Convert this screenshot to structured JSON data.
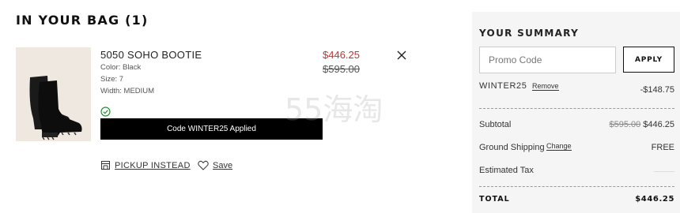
{
  "bag": {
    "title": "IN YOUR BAG (1)"
  },
  "item": {
    "name": "5050 SOHO BOOTIE",
    "color": "Color: Black",
    "size": "Size: 7",
    "width": "Width: MEDIUM",
    "sale_price": "$446.25",
    "original_price": "$595.00",
    "code_applied": "Code WINTER25 Applied",
    "pickup_label": "PICKUP INSTEAD",
    "save_label": "Save",
    "image_icon": "boot-icon"
  },
  "watermark": "55海淘",
  "summary": {
    "title": "YOUR SUMMARY",
    "promo_placeholder": "Promo Code",
    "apply_label": "APPLY",
    "code_name": "WINTER25",
    "code_remove": "Remove",
    "code_amount": "-$148.75",
    "subtotal_label": "Subtotal",
    "subtotal_original": "$595.00",
    "subtotal_value": "$446.25",
    "shipping_label": "Ground Shipping",
    "shipping_change": "Change",
    "shipping_value": "FREE",
    "tax_label": "Estimated Tax",
    "total_label": "TOTAL",
    "total_value": "$446.25"
  },
  "colors": {
    "accent_sale": "#c9302c",
    "banner_bg": "#000000",
    "summary_bg": "#f5f5f5"
  }
}
